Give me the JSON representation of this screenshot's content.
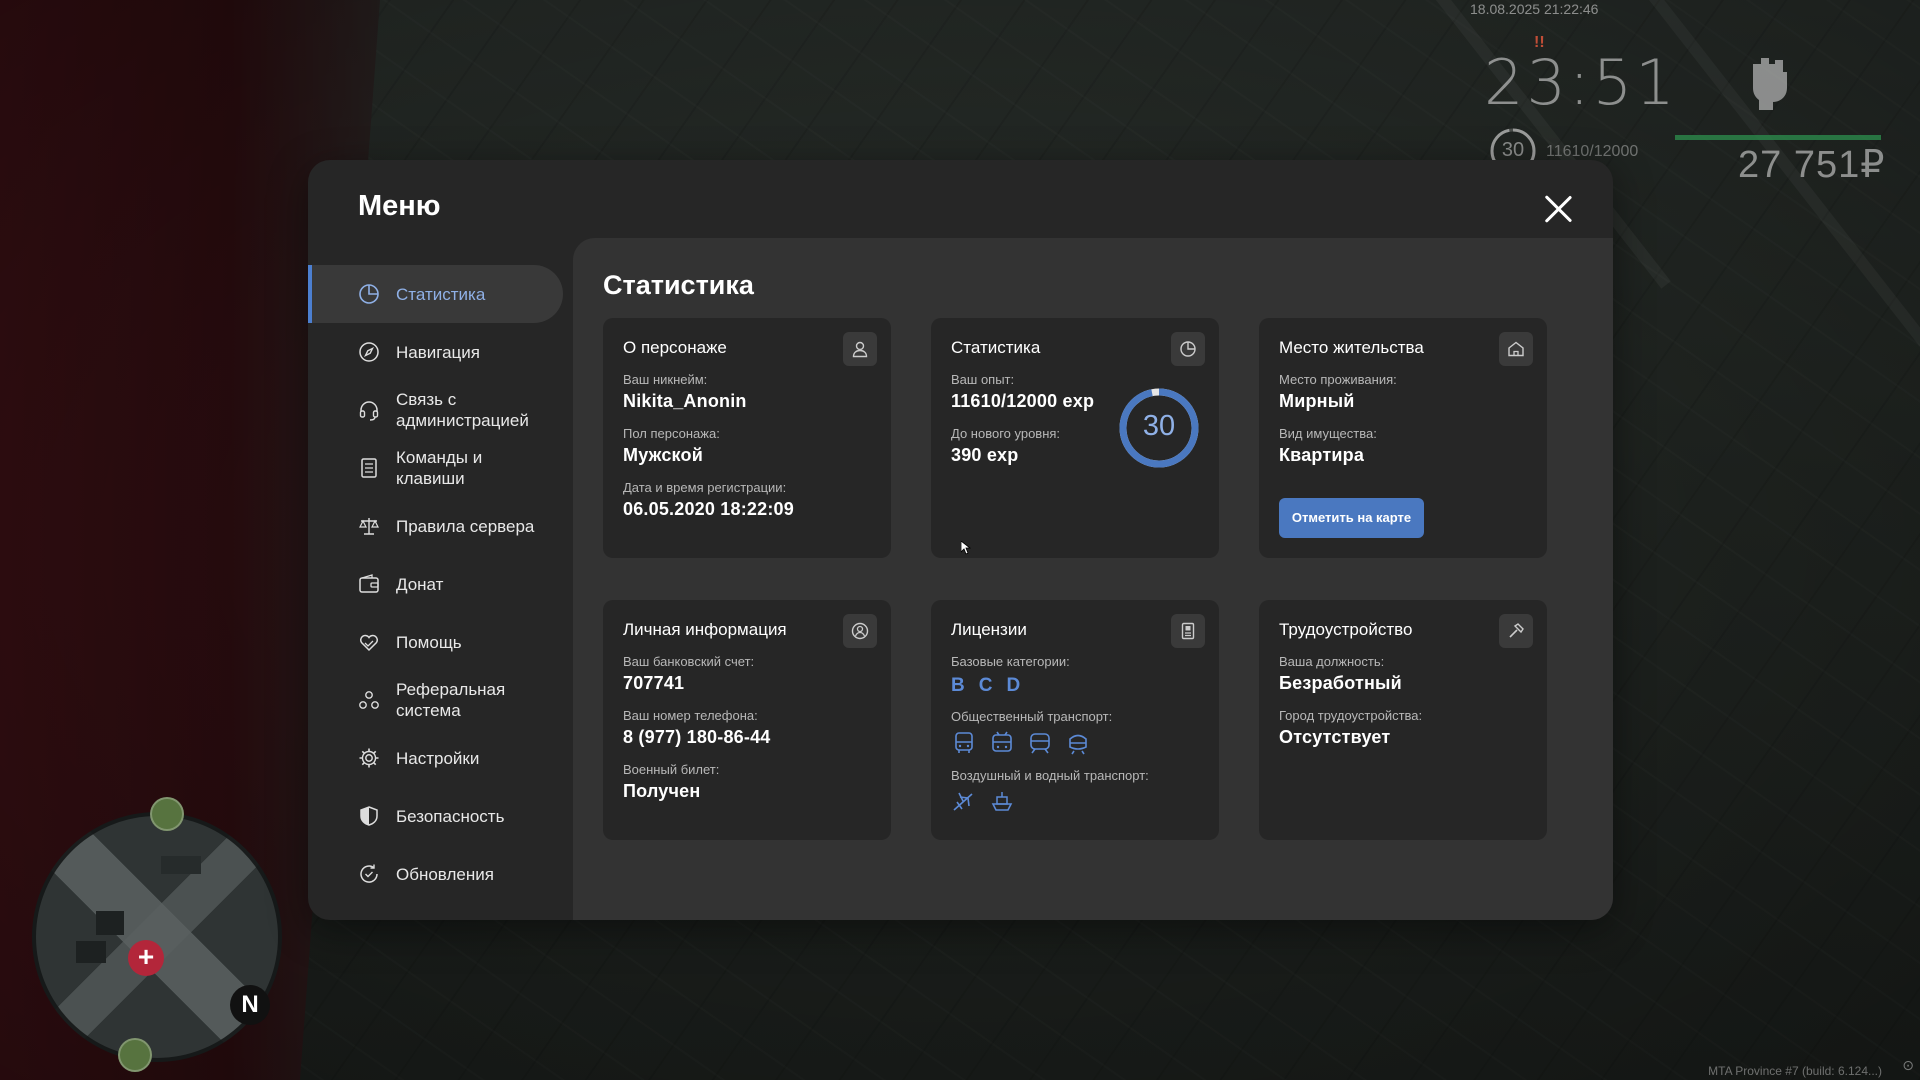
{
  "hud": {
    "date": "18.08.2025 21:22:46",
    "alert": "!!",
    "time": "23:51",
    "level": "30",
    "exp": "11610/12000",
    "health_fill": 1.0,
    "money": "27 751₽",
    "build": "MTA Province #7 (build: 6.124...)",
    "minimap_north": "N"
  },
  "menu": {
    "title": "Меню",
    "sidebar": [
      {
        "label": "Статистика",
        "icon": "pie-chart-icon"
      },
      {
        "label": "Навигация",
        "icon": "compass-icon"
      },
      {
        "label": "Связь с\nадминистрацией",
        "icon": "headset-icon"
      },
      {
        "label": "Команды и\nклавиши",
        "icon": "document-icon"
      },
      {
        "label": "Правила сервера",
        "icon": "scales-icon"
      },
      {
        "label": "Донат",
        "icon": "wallet-icon"
      },
      {
        "label": "Помощь",
        "icon": "heart-hand-icon"
      },
      {
        "label": "Реферальная\nсистема",
        "icon": "people-icon"
      },
      {
        "label": "Настройки",
        "icon": "gear-icon"
      },
      {
        "label": "Безопасность",
        "icon": "shield-icon"
      },
      {
        "label": "Обновления",
        "icon": "refresh-check-icon"
      }
    ]
  },
  "stats": {
    "title": "Статистика",
    "about": {
      "head": "О персонаже",
      "nick_label": "Ваш никнейм:",
      "nick": "Nikita_Anonin",
      "sex_label": "Пол персонажа:",
      "sex": "Мужской",
      "reg_label": "Дата и время регистрации:",
      "reg": "06.05.2020 18:22:09"
    },
    "statistics": {
      "head": "Статистика",
      "exp_label": "Ваш опыт:",
      "exp": "11610/12000 exp",
      "next_label": "До нового уровня:",
      "next": "390 exp",
      "level": "30",
      "progress": 0.9675
    },
    "residence": {
      "head": "Место жительства",
      "place_label": "Место проживания:",
      "place": "Мирный",
      "type_label": "Вид имущества:",
      "type": "Квартира",
      "button": "Отметить на карте"
    },
    "personal": {
      "head": "Личная информация",
      "bank_label": "Ваш банковский счет:",
      "bank": "707741",
      "phone_label": "Ваш номер телефона:",
      "phone": "8 (977) 180-86-44",
      "military_label": "Военный билет:",
      "military": "Получен"
    },
    "licenses": {
      "head": "Лицензии",
      "base_label": "Базовые категории:",
      "categories": [
        "B",
        "C",
        "D"
      ],
      "public_label": "Общественный транспорт:",
      "air_label": "Воздушный и водный транспорт:"
    },
    "employment": {
      "head": "Трудоустройство",
      "post_label": "Ваша должность:",
      "post": "Безработный",
      "city_label": "Город трудоустройства:",
      "city": "Отсутствует"
    }
  }
}
